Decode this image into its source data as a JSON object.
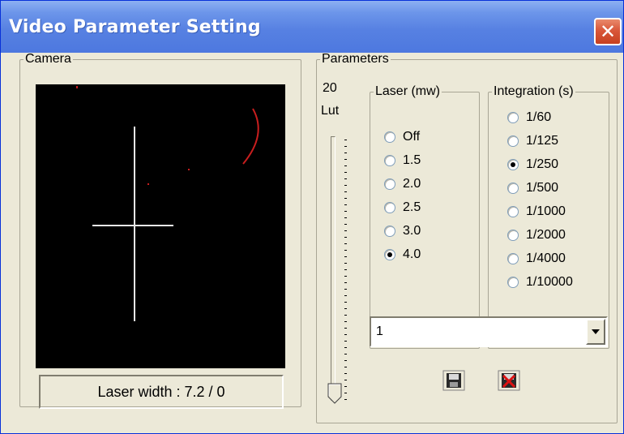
{
  "window": {
    "title": "Video Parameter Setting",
    "close_label": "✕"
  },
  "camera": {
    "group_label": "Camera",
    "laser_width": "Laser width : 7.2 / 0"
  },
  "parameters": {
    "group_label": "Parameters",
    "lut_value": "20",
    "lut_label": "Lut",
    "laser": {
      "group_label": "Laser (mw)",
      "options": [
        "Off",
        "1.5",
        "2.0",
        "2.5",
        "3.0",
        "4.0"
      ],
      "selected": "4.0"
    },
    "integration": {
      "group_label": "Integration (s)",
      "options": [
        "1/60",
        "1/125",
        "1/250",
        "1/500",
        "1/1000",
        "1/2000",
        "1/4000",
        "1/10000"
      ],
      "selected": "1/250"
    },
    "combo_value": "1"
  },
  "icons": {
    "save": "save-icon",
    "delete": "delete-icon",
    "dropdown": "chevron-down-icon"
  }
}
